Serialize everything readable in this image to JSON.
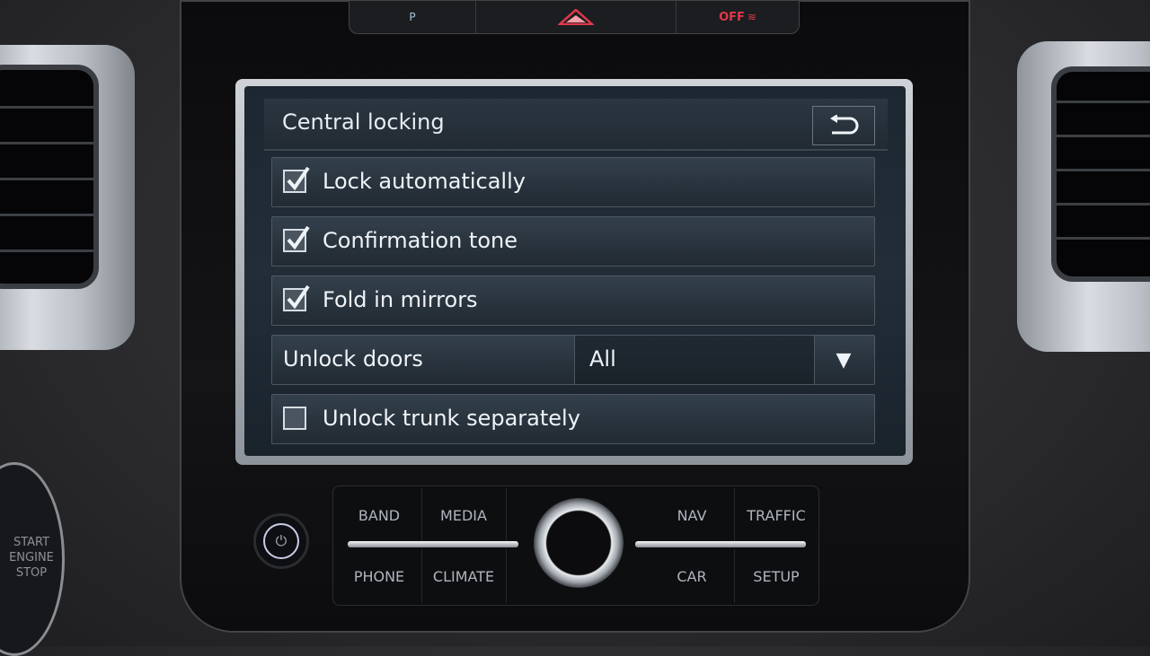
{
  "screen": {
    "title": "Central locking",
    "back_icon": "return-arrow-icon",
    "items": [
      {
        "type": "checkbox",
        "label": "Lock automatically",
        "checked": true
      },
      {
        "type": "checkbox",
        "label": "Confirmation tone",
        "checked": true
      },
      {
        "type": "checkbox",
        "label": "Fold in mirrors",
        "checked": true
      },
      {
        "type": "dropdown",
        "label": "Unlock doors",
        "value": "All",
        "icon": "triangle-down-icon"
      },
      {
        "type": "checkbox",
        "label": "Unlock trunk separately",
        "checked": false
      }
    ]
  },
  "top_buttons": {
    "park_assist": "P",
    "hazard_icon": "hazard-triangle-icon",
    "esc_off": "OFF"
  },
  "hardware_buttons": {
    "band": "BAND",
    "media": "MEDIA",
    "nav": "NAV",
    "traffic": "TRAFFIC",
    "phone": "PHONE",
    "climate": "CLIMATE",
    "car": "CAR",
    "setup": "SETUP"
  },
  "power_icon": "⏻",
  "start_stop": {
    "line1": "START",
    "line2": "ENGINE",
    "line3": "STOP"
  },
  "colors": {
    "screen_bg": "#222d38",
    "text": "#eef3f7",
    "hazard": "#e0384a"
  }
}
